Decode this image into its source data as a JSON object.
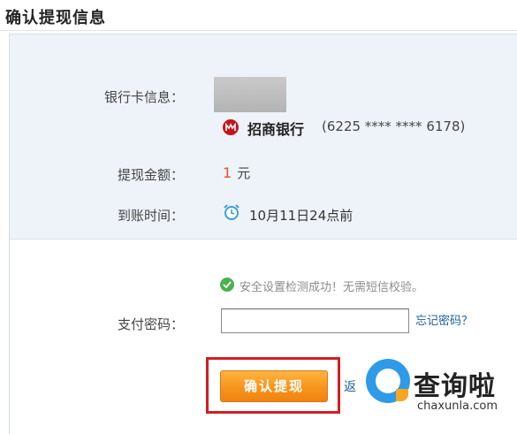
{
  "page": {
    "title": "确认提现信息"
  },
  "bank_card": {
    "label": "银行卡信息：",
    "bank_name": "招商银行",
    "card_number": "(6225 **** **** 6178)",
    "logo_icon": "cmb-bank-logo-icon",
    "logo_color": "#c4161c"
  },
  "amount": {
    "label": "提现金额：",
    "value": "1",
    "unit": "元",
    "value_color": "#e4502a"
  },
  "arrival": {
    "label": "到账时间：",
    "value": "10月11日24点前",
    "icon": "alarm-clock-icon"
  },
  "security": {
    "message": "安全设置检测成功！无需短信校验。",
    "icon": "check-circle-icon"
  },
  "password": {
    "label": "支付密码：",
    "value": "",
    "forgot_link": "忘记密码？"
  },
  "actions": {
    "confirm_label": "确认提现",
    "return_link": "返"
  },
  "watermark": {
    "text": "查询啦",
    "url": "chaxunla.com"
  },
  "colors": {
    "accent": "#f7941d",
    "link": "#1b5ea6",
    "panel_bg": "#eef3f9",
    "highlight": "#d11f24",
    "success": "#4bb14d"
  }
}
